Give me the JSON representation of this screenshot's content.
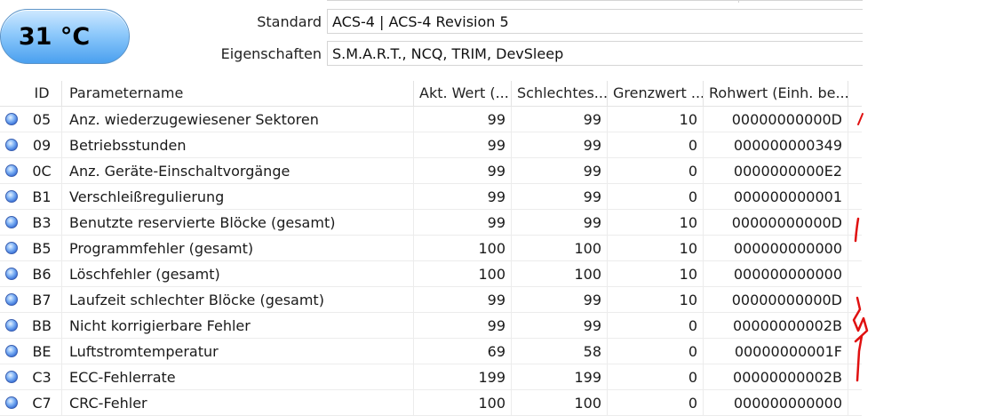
{
  "temperature": {
    "value": "31 °C",
    "status_color": "#4aa0ef"
  },
  "info": [
    {
      "label": "Standard",
      "value": "ACS-4 | ACS-4 Revision 5"
    },
    {
      "label": "Eigenschaften",
      "value": "S.M.A.R.T., NCQ, TRIM, DevSleep"
    }
  ],
  "table": {
    "headers": {
      "id": "ID",
      "name": "Parametername",
      "current": "Akt. Wert (...",
      "worst": "Schlechtes...",
      "threshold": "Grenzwert ...",
      "raw": "Rohwert (Einh. be..."
    },
    "status_icon": "blue-status-dot-icon",
    "rows": [
      {
        "id": "05",
        "name": "Anz. wiederzugewiesener Sektoren",
        "current": "99",
        "worst": "99",
        "threshold": "10",
        "raw": "00000000000D"
      },
      {
        "id": "09",
        "name": "Betriebsstunden",
        "current": "99",
        "worst": "99",
        "threshold": "0",
        "raw": "000000000349"
      },
      {
        "id": "0C",
        "name": "Anz. Geräte-Einschaltvorgänge",
        "current": "99",
        "worst": "99",
        "threshold": "0",
        "raw": "0000000000E2"
      },
      {
        "id": "B1",
        "name": "Verschleißregulierung",
        "current": "99",
        "worst": "99",
        "threshold": "0",
        "raw": "000000000001"
      },
      {
        "id": "B3",
        "name": "Benutzte reservierte Blöcke (gesamt)",
        "current": "99",
        "worst": "99",
        "threshold": "10",
        "raw": "00000000000D"
      },
      {
        "id": "B5",
        "name": "Programmfehler (gesamt)",
        "current": "100",
        "worst": "100",
        "threshold": "10",
        "raw": "000000000000"
      },
      {
        "id": "B6",
        "name": "Löschfehler (gesamt)",
        "current": "100",
        "worst": "100",
        "threshold": "10",
        "raw": "000000000000"
      },
      {
        "id": "B7",
        "name": "Laufzeit schlechter Blöcke (gesamt)",
        "current": "99",
        "worst": "99",
        "threshold": "10",
        "raw": "00000000000D"
      },
      {
        "id": "BB",
        "name": "Nicht korrigierbare Fehler",
        "current": "99",
        "worst": "99",
        "threshold": "0",
        "raw": "00000000002B"
      },
      {
        "id": "BE",
        "name": "Luftstromtemperatur",
        "current": "69",
        "worst": "58",
        "threshold": "0",
        "raw": "00000000001F"
      },
      {
        "id": "C3",
        "name": "ECC-Fehlerrate",
        "current": "199",
        "worst": "199",
        "threshold": "0",
        "raw": "00000000002B"
      },
      {
        "id": "C7",
        "name": "CRC-Fehler",
        "current": "100",
        "worst": "100",
        "threshold": "0",
        "raw": "000000000000"
      }
    ]
  },
  "annotation_color": "#e01010"
}
